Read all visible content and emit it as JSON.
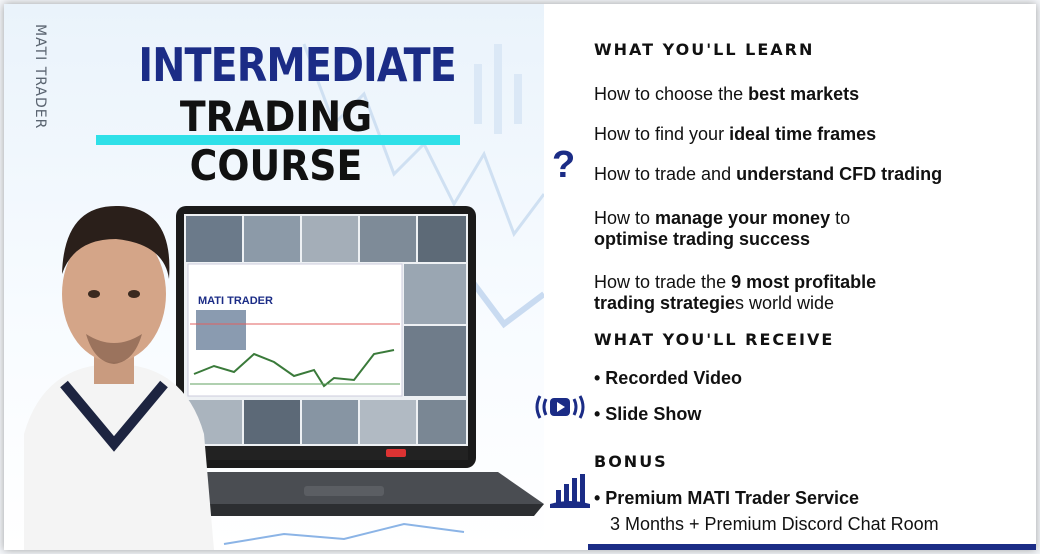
{
  "left": {
    "vertical_brand": "MATI TRADER",
    "title_line1": "INTERMEDIATE",
    "title_line2": "TRADING",
    "title_line3": "COURSE",
    "screen_brand": "MATI TRADER"
  },
  "right": {
    "learn_heading": "WHAT YOU'LL LEARN",
    "learn_items": [
      {
        "pre": "How to choose the ",
        "bold": "best markets",
        "post": ""
      },
      {
        "pre": "How to find your ",
        "bold": "ideal time frames",
        "post": ""
      },
      {
        "pre": "How to trade and ",
        "bold": "understand CFD trading",
        "post": ""
      }
    ],
    "learn_item4_line1_pre": "How to ",
    "learn_item4_line1_bold": "manage your money",
    "learn_item4_line1_post": " to",
    "learn_item4_line2_bold": "optimise trading success",
    "learn_item5_line1_pre": "How to trade the ",
    "learn_item5_line1_bold": "9 most profitable",
    "learn_item5_line2_bold": "trading strategie",
    "learn_item5_line2_post": "s world wide",
    "receive_heading": "WHAT YOU'LL RECEIVE",
    "receive_items": [
      "• Recorded Video",
      "• Slide Show"
    ],
    "bonus_heading": "BONUS",
    "bonus_item": "• Premium MATI Trader Service",
    "bonus_subline": "3 Months + Premium Discord Chat Room"
  },
  "icons": {
    "question": "question-mark-icon",
    "video": "video-play-icon",
    "chart": "bar-chart-icon"
  },
  "colors": {
    "brand_blue": "#1b2c86",
    "accent_cyan": "#2fe0e8"
  }
}
